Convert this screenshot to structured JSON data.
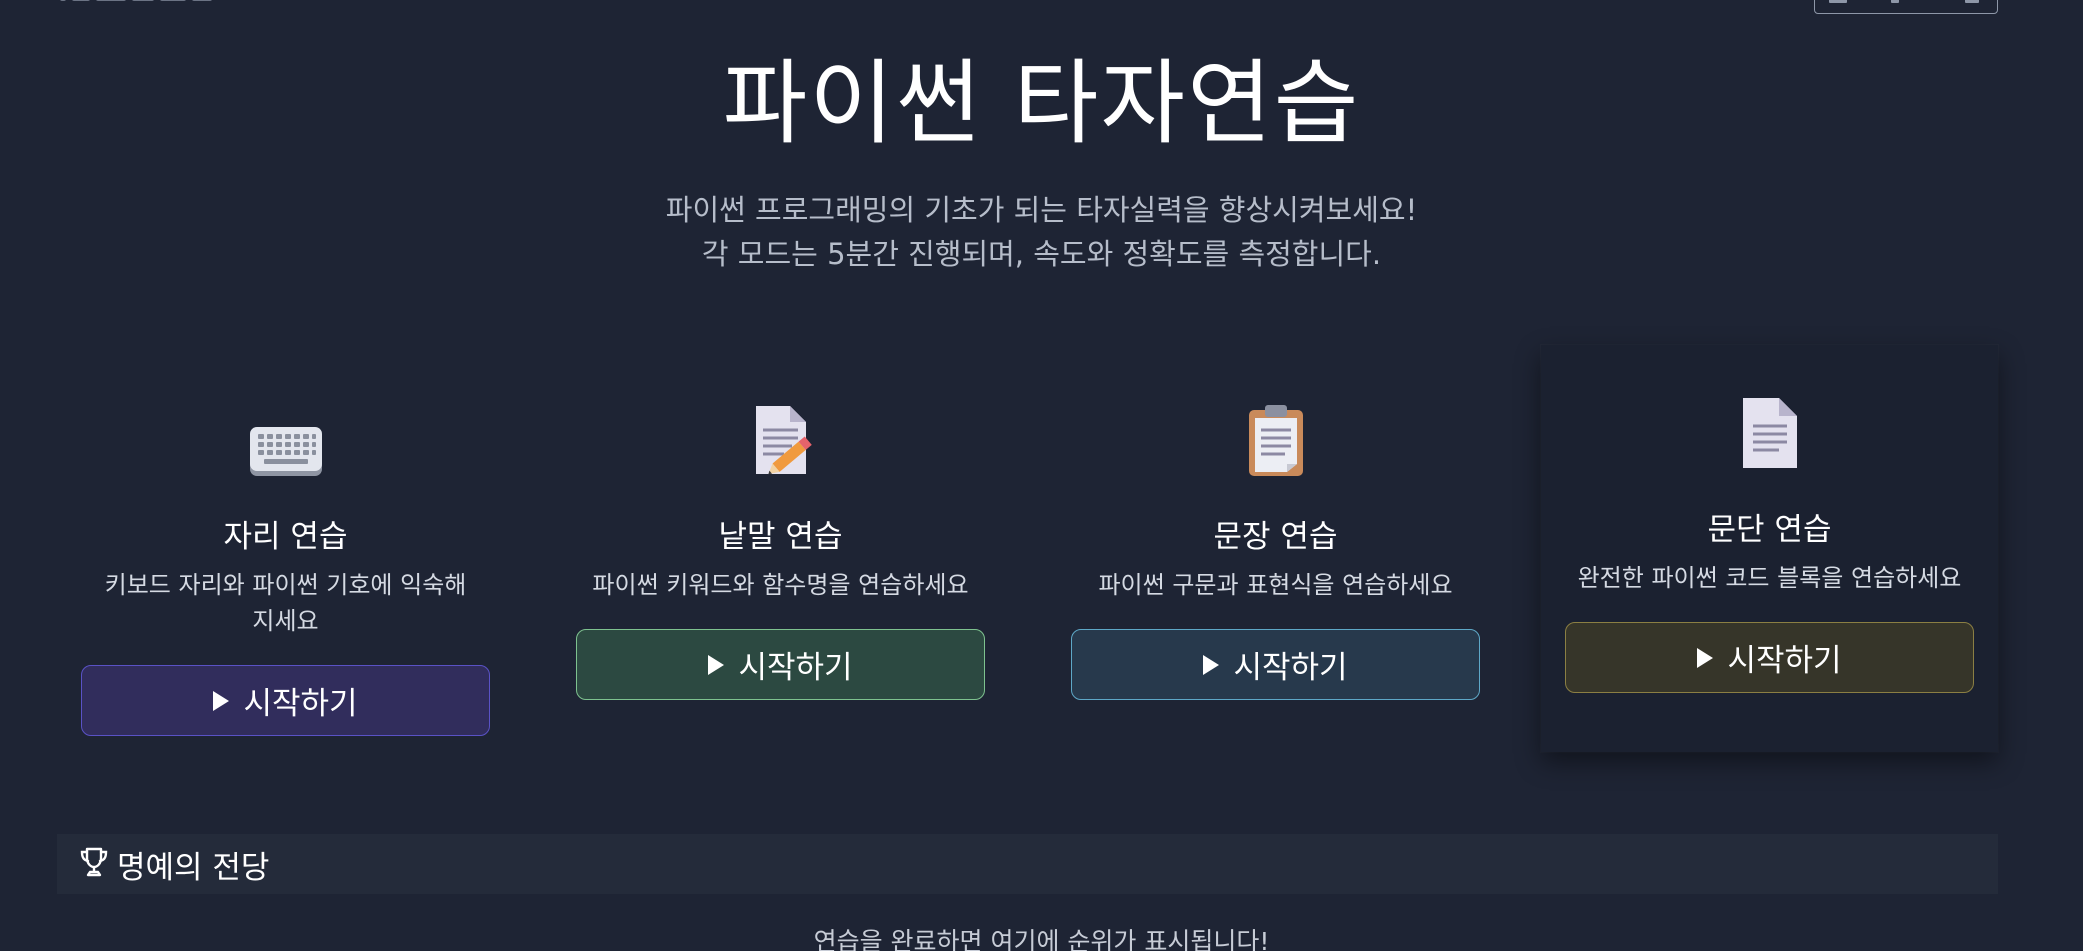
{
  "hero": {
    "title": "파이썬 타자연습",
    "subtitle_line1": "파이썬 프로그래밍의 기초가 되는 타자실력을 향상시켜보세요!",
    "subtitle_line2": "각 모드는 5분간 진행되며, 속도와 정확도를 측정합니다."
  },
  "modes": [
    {
      "icon": "keyboard-icon",
      "title": "자리 연습",
      "description": "키보드 자리와 파이썬 기호에 익숙해지세요",
      "button_label": "시작하기",
      "accent": "#5a52c6"
    },
    {
      "icon": "memo-pencil-icon",
      "title": "낱말 연습",
      "description": "파이썬 키워드와 함수명을 연습하세요",
      "button_label": "시작하기",
      "accent": "#7ec28f"
    },
    {
      "icon": "clipboard-icon",
      "title": "문장 연습",
      "description": "파이썬 구문과 표현식을 연습하세요",
      "button_label": "시작하기",
      "accent": "#5ea8c7"
    },
    {
      "icon": "document-icon",
      "title": "문단 연습",
      "description": "완전한 파이썬 코드 블록을 연습하세요",
      "button_label": "시작하기",
      "accent": "#8b7f43"
    }
  ],
  "hall_of_fame": {
    "icon": "trophy-icon",
    "title": "명예의 전당",
    "empty_message": "연습을 완료하면 여기에 순위가 표시됩니다!"
  },
  "colors": {
    "background": "#1e2434",
    "text_primary": "#ffffff",
    "text_secondary": "#b6bdca"
  }
}
